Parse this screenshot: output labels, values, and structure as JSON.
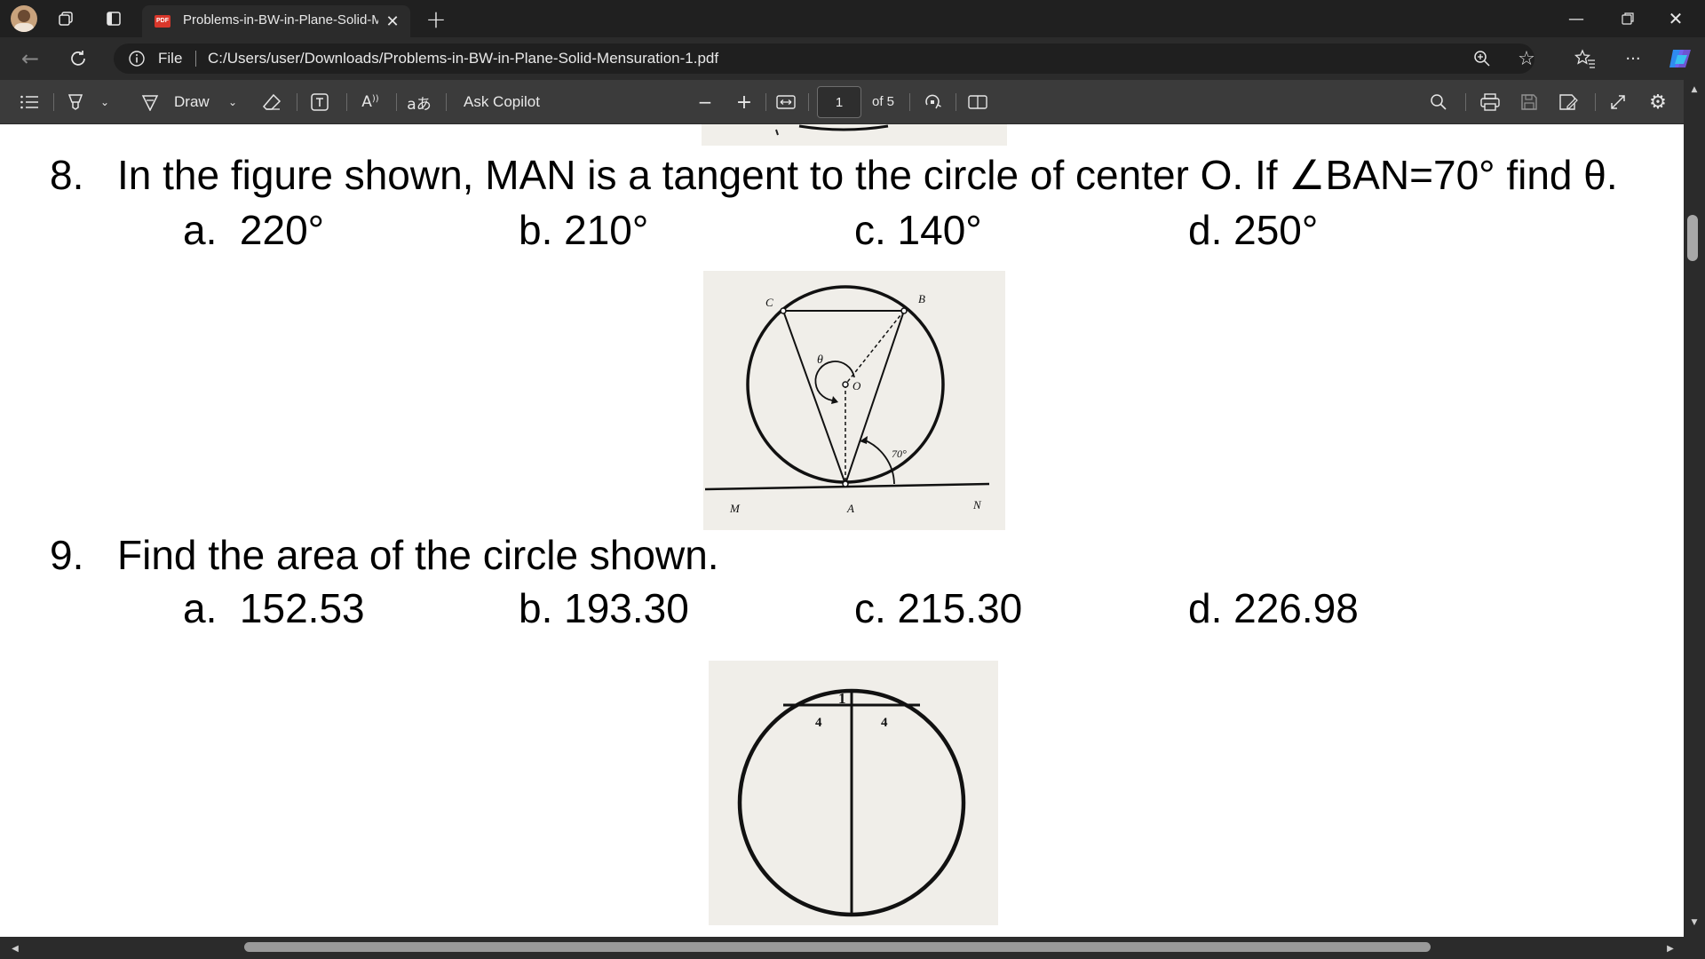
{
  "browser": {
    "tab_title": "Problems-in-BW-in-Plane-Solid-M",
    "new_tab": "+",
    "url_prefix": "File",
    "url": "C:/Users/user/Downloads/Problems-in-BW-in-Plane-Solid-Mensuration-1.pdf",
    "more": "···"
  },
  "pdf_toolbar": {
    "draw_label": "Draw",
    "copilot_label": "Ask Copilot",
    "page_current": "1",
    "page_total": "of 5",
    "read_aloud": "A",
    "translate": "aあ"
  },
  "document": {
    "q8": {
      "number": "8.",
      "text": "In the figure shown, MAN is a tangent to the circle of center O. If ∠BAN=70° find θ.",
      "options": [
        "a.  220°",
        "b. 210°",
        "c. 140°",
        "d. 250°"
      ],
      "figure_labels": {
        "c": "C",
        "b": "B",
        "theta": "θ",
        "o": "O",
        "angle": "70°",
        "m": "M",
        "a": "A",
        "n": "N"
      }
    },
    "q9": {
      "number": "9.",
      "text": "Find the area of the circle shown.",
      "options": [
        "a.  152.53",
        "b. 193.30",
        "c. 215.30",
        "d. 226.98"
      ],
      "figure_labels": {
        "one": "1",
        "left": "4",
        "right": "4"
      }
    }
  }
}
